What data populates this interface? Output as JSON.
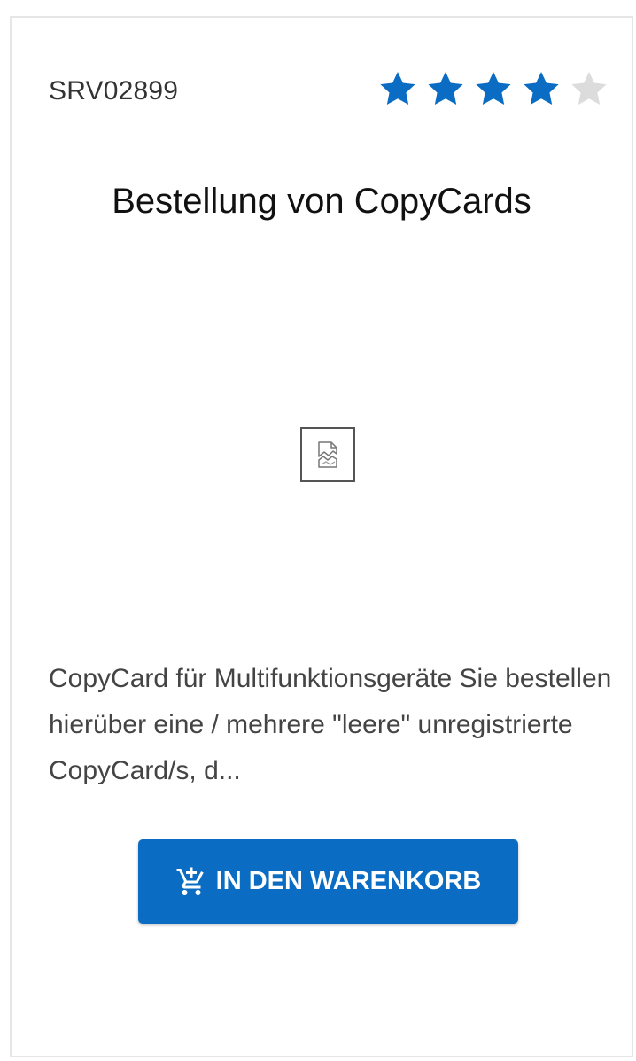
{
  "product": {
    "sku": "SRV02899",
    "rating": 4,
    "rating_max": 5,
    "title": "Bestellung von CopyCards",
    "image_icon": "broken-image-icon",
    "description": "CopyCard für Multifunktionsgeräte Sie bestellen hierüber eine / mehrere \"leere\" unregistrierte CopyCard/s, d...",
    "add_to_cart_label": "IN DEN WARENKORB",
    "add_to_cart_icon": "add-to-cart-icon"
  },
  "colors": {
    "accent": "#0a6cc2",
    "star_filled": "#0a6cc2",
    "star_empty": "#dcdcdc",
    "border": "#e6e6e6"
  }
}
